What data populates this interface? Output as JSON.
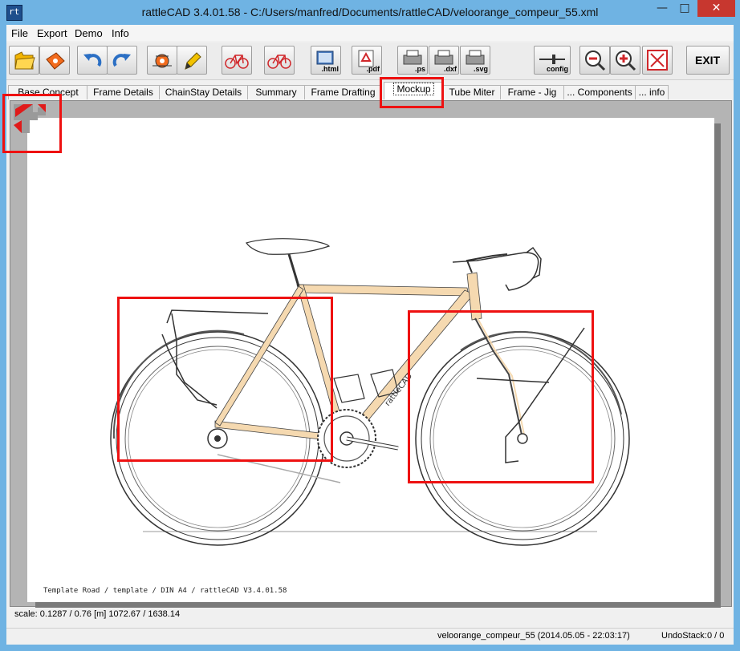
{
  "window": {
    "title": "rattleCAD  3.4.01.58 - C:/Users/manfred/Documents/rattleCAD/veloorange_compeur_55.xml",
    "minimize_glyph": "—",
    "maximize_glyph": "□",
    "close_glyph": "✕"
  },
  "menu": [
    "File",
    "Export",
    "Demo",
    "Info"
  ],
  "toolbar": {
    "html_label": ".html",
    "pdf_label": ".pdf",
    "ps_label": ".ps",
    "dxf_label": ".dxf",
    "svg_label": ".svg",
    "config_label": "config",
    "exit_label": "EXIT"
  },
  "tabs": [
    "Base Concept",
    "Frame Details",
    "ChainStay Details",
    "Summary",
    "Frame Drafting",
    "Mockup",
    "Tube Miter",
    "Frame - Jig",
    "... Components",
    "... info"
  ],
  "active_tab": "Mockup",
  "canvas": {
    "footer_text": "Template Road  /  template  / DIN A4 /  rattleCAD  V3.4.01.58"
  },
  "status": {
    "scale": "scale: 0.1287 / 0.76  [m]  1072.67 / 1638.14",
    "file": "veloorange_compeur_55 (2014.05.05 - 22:03:17)",
    "undo_label": "UndoStack:",
    "undo_value": "0 / 0"
  },
  "colors": {
    "highlight": "#ee1111",
    "frame_tube": "#f5d9b0",
    "title_bar": "#6fb3e3"
  }
}
